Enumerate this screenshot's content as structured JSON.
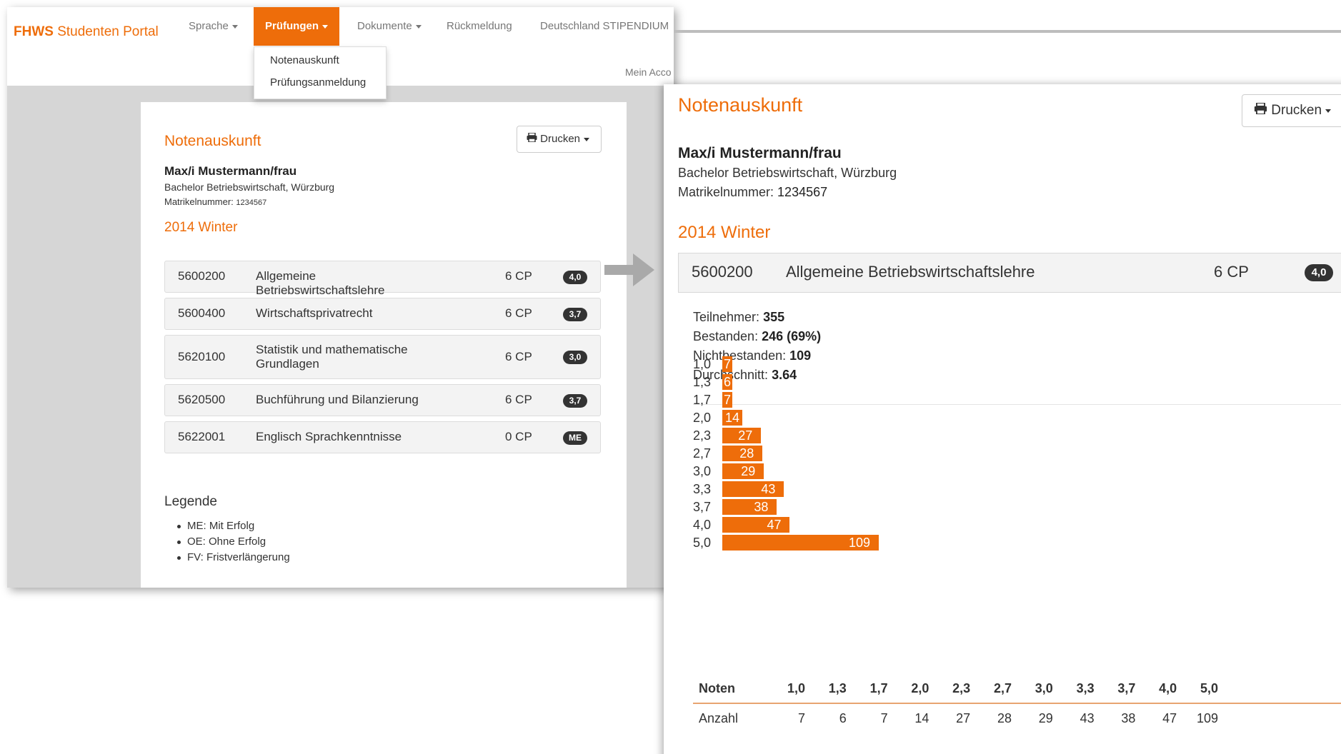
{
  "nav": {
    "brand_bold": "FHWS",
    "brand_rest": " Studenten Portal",
    "items": [
      {
        "label": "Sprache",
        "has_caret": true
      },
      {
        "label": "Prüfungen",
        "has_caret": true,
        "active": true
      },
      {
        "label": "Dokumente",
        "has_caret": true
      },
      {
        "label": "Rückmeldung",
        "has_caret": false
      },
      {
        "label": "Deutschland STIPENDIUM",
        "has_caret": false
      }
    ],
    "account": "Mein Acco",
    "dropdown": [
      "Notenauskunft",
      "Prüfungsanmeldung"
    ]
  },
  "left": {
    "title": "Notenauskunft",
    "print_label": "Drucken",
    "student": {
      "name": "Max/i Mustermann/frau",
      "program": "Bachelor Betriebswirtschaft, Würzburg",
      "matrikel_label": "Matrikelnummer:",
      "matrikel": "1234567"
    },
    "semester": "2014 Winter",
    "courses": [
      {
        "id": "5600200",
        "name": "Allgemeine Betriebswirtschaftslehre",
        "cp": "6 CP",
        "grade": "4,0"
      },
      {
        "id": "5600400",
        "name": "Wirtschaftsprivatrecht",
        "cp": "6 CP",
        "grade": "3,7"
      },
      {
        "id": "5620100",
        "name": "Statistik und mathematische Grundlagen",
        "cp": "6 CP",
        "grade": "3,0"
      },
      {
        "id": "5620500",
        "name": "Buchführung und Bilanzierung",
        "cp": "6 CP",
        "grade": "3,7"
      },
      {
        "id": "5622001",
        "name": "Englisch Sprachkenntnisse",
        "cp": "0 CP",
        "grade": "ME"
      }
    ],
    "legend_title": "Legende",
    "legend": [
      "ME: Mit Erfolg",
      "OE: Ohne Erfolg",
      "FV: Fristverlängerung"
    ]
  },
  "right": {
    "title": "Notenauskunft",
    "print_label": "Drucken",
    "student": {
      "name": "Max/i Mustermann/frau",
      "program": "Bachelor Betriebswirtschaft, Würzburg",
      "matrikel_label": "Matrikelnummer:",
      "matrikel": "1234567"
    },
    "semester": "2014 Winter",
    "course": {
      "id": "5600200",
      "name": "Allgemeine Betriebswirtschaftslehre",
      "cp": "6 CP",
      "grade": "4,0"
    },
    "stats": [
      {
        "label": "Teilnehmer:",
        "value": "355"
      },
      {
        "label": "Bestanden:",
        "value": "246 (69%)"
      },
      {
        "label": "Nichtbestanden:",
        "value": "109"
      },
      {
        "label": "Durchschnitt:",
        "value": "3.64"
      }
    ],
    "table": {
      "head_label": "Noten",
      "row_label": "Anzahl"
    }
  },
  "colors": {
    "accent": "#ee6d0a",
    "badge": "#333333"
  },
  "chart_data": {
    "type": "bar",
    "orientation": "horizontal",
    "categories": [
      "1,0",
      "1,3",
      "1,7",
      "2,0",
      "2,3",
      "2,7",
      "3,0",
      "3,3",
      "3,7",
      "4,0",
      "5,0"
    ],
    "values": [
      7,
      6,
      7,
      14,
      27,
      28,
      29,
      43,
      38,
      47,
      109
    ],
    "title": "",
    "xlabel": "",
    "ylabel": ""
  }
}
